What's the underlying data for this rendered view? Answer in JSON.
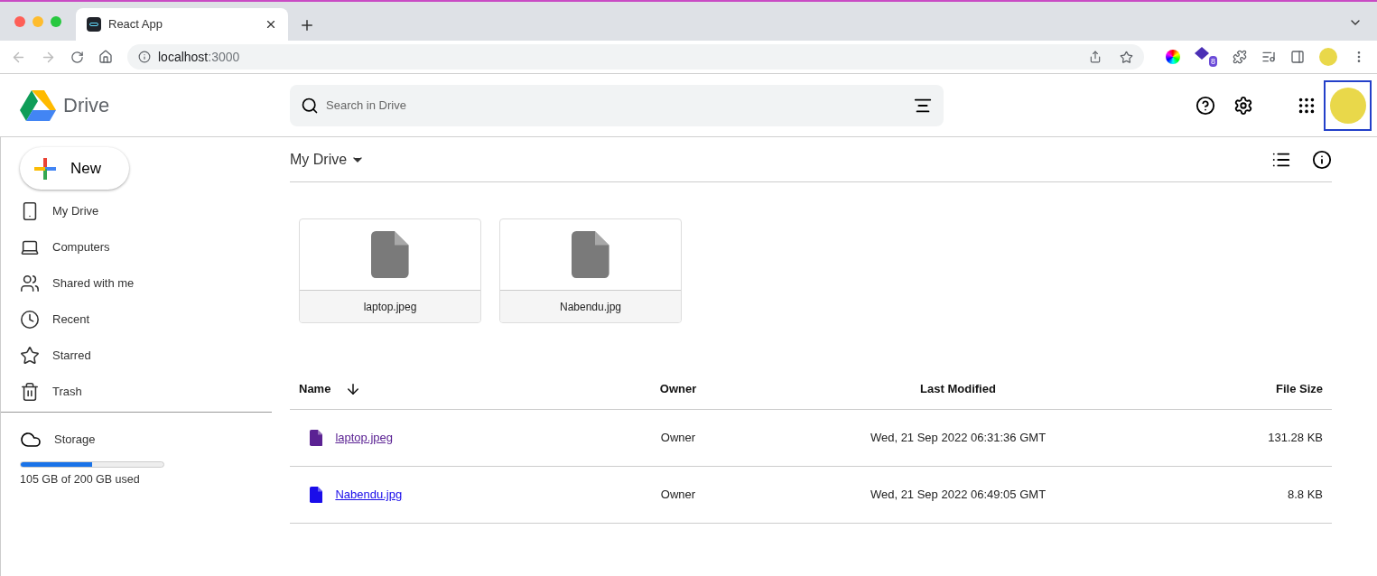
{
  "browser": {
    "tab_title": "React App",
    "address_host": "localhost",
    "address_port": ":3000",
    "extension_badge": "8"
  },
  "header": {
    "logo_text": "Drive",
    "search": {
      "placeholder": "Search in Drive"
    }
  },
  "sidebar": {
    "new_button": "New",
    "items": [
      {
        "label": "My Drive",
        "kind": "mydrive"
      },
      {
        "label": "Computers",
        "kind": "computers"
      },
      {
        "label": "Shared with me",
        "kind": "shared"
      },
      {
        "label": "Recent",
        "kind": "recent"
      },
      {
        "label": "Starred",
        "kind": "starred"
      },
      {
        "label": "Trash",
        "kind": "trash"
      }
    ],
    "storage": {
      "label": "Storage",
      "level": 0.5,
      "usage": "105 GB of 200 GB used"
    }
  },
  "main": {
    "title": "My Drive",
    "cards": [
      {
        "name": "laptop.jpeg"
      },
      {
        "name": "Nabendu.jpg"
      }
    ],
    "table": {
      "columns": [
        "Name",
        "Owner",
        "Last Modified",
        "File Size"
      ],
      "rows": [
        {
          "name": "laptop.jpeg",
          "visited": true,
          "owner": "Owner",
          "modified": "Wed, 21 Sep 2022 06:31:36 GMT",
          "size": "131.28 KB"
        },
        {
          "name": "Nabendu.jpg",
          "visited": false,
          "owner": "Owner",
          "modified": "Wed, 21 Sep 2022 06:49:05 GMT",
          "size": "8.8 KB"
        }
      ]
    }
  }
}
